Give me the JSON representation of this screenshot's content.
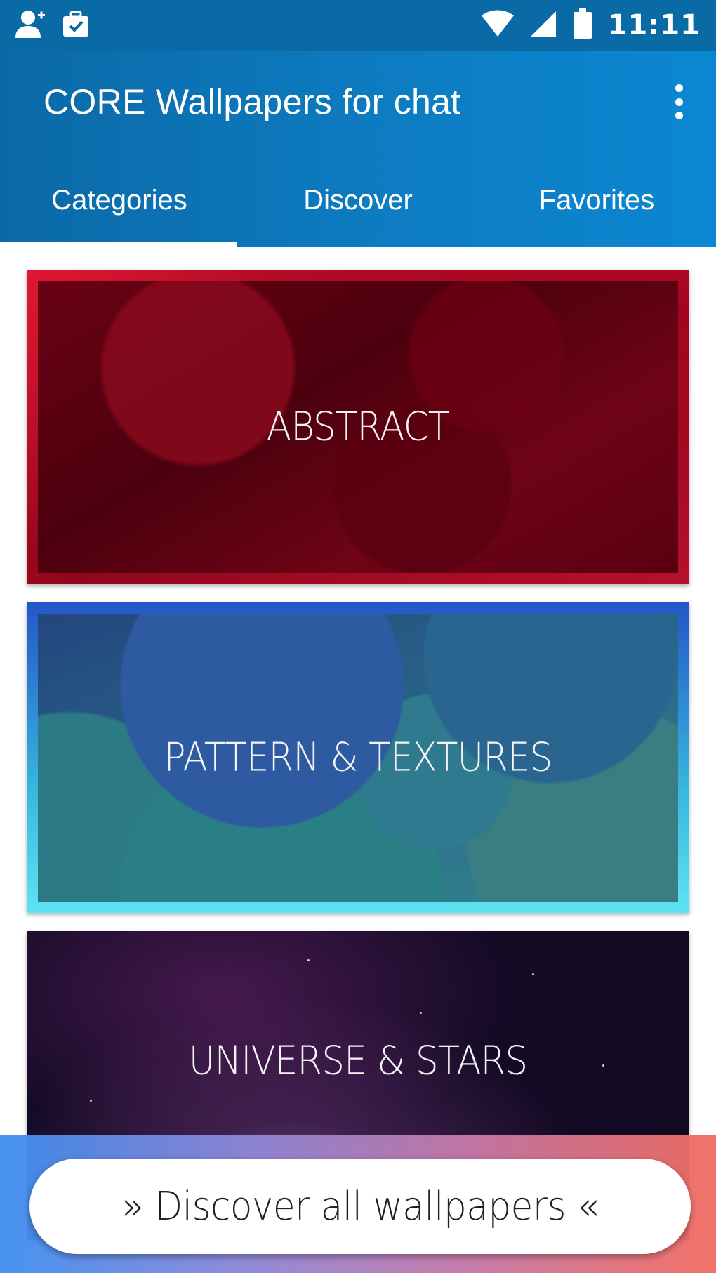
{
  "status_bar": {
    "time": "11:11",
    "left_icons": [
      "add-person-icon",
      "briefcase-check-icon"
    ],
    "right_icons": [
      "wifi-icon",
      "cellular-signal-icon",
      "battery-icon"
    ]
  },
  "app_bar": {
    "title": "CORE Wallpapers for chat",
    "overflow_icon": "more-vert-icon",
    "color": "#0b78bd"
  },
  "tabs": [
    {
      "label": "Categories",
      "selected": true
    },
    {
      "label": "Discover",
      "selected": false
    },
    {
      "label": "Favorites",
      "selected": false
    }
  ],
  "categories": [
    {
      "label": "ABSTRACT"
    },
    {
      "label": "PATTERN & TEXTURES"
    },
    {
      "label": "UNIVERSE & STARS"
    }
  ],
  "discover_button": {
    "label": "» Discover all wallpapers «"
  }
}
